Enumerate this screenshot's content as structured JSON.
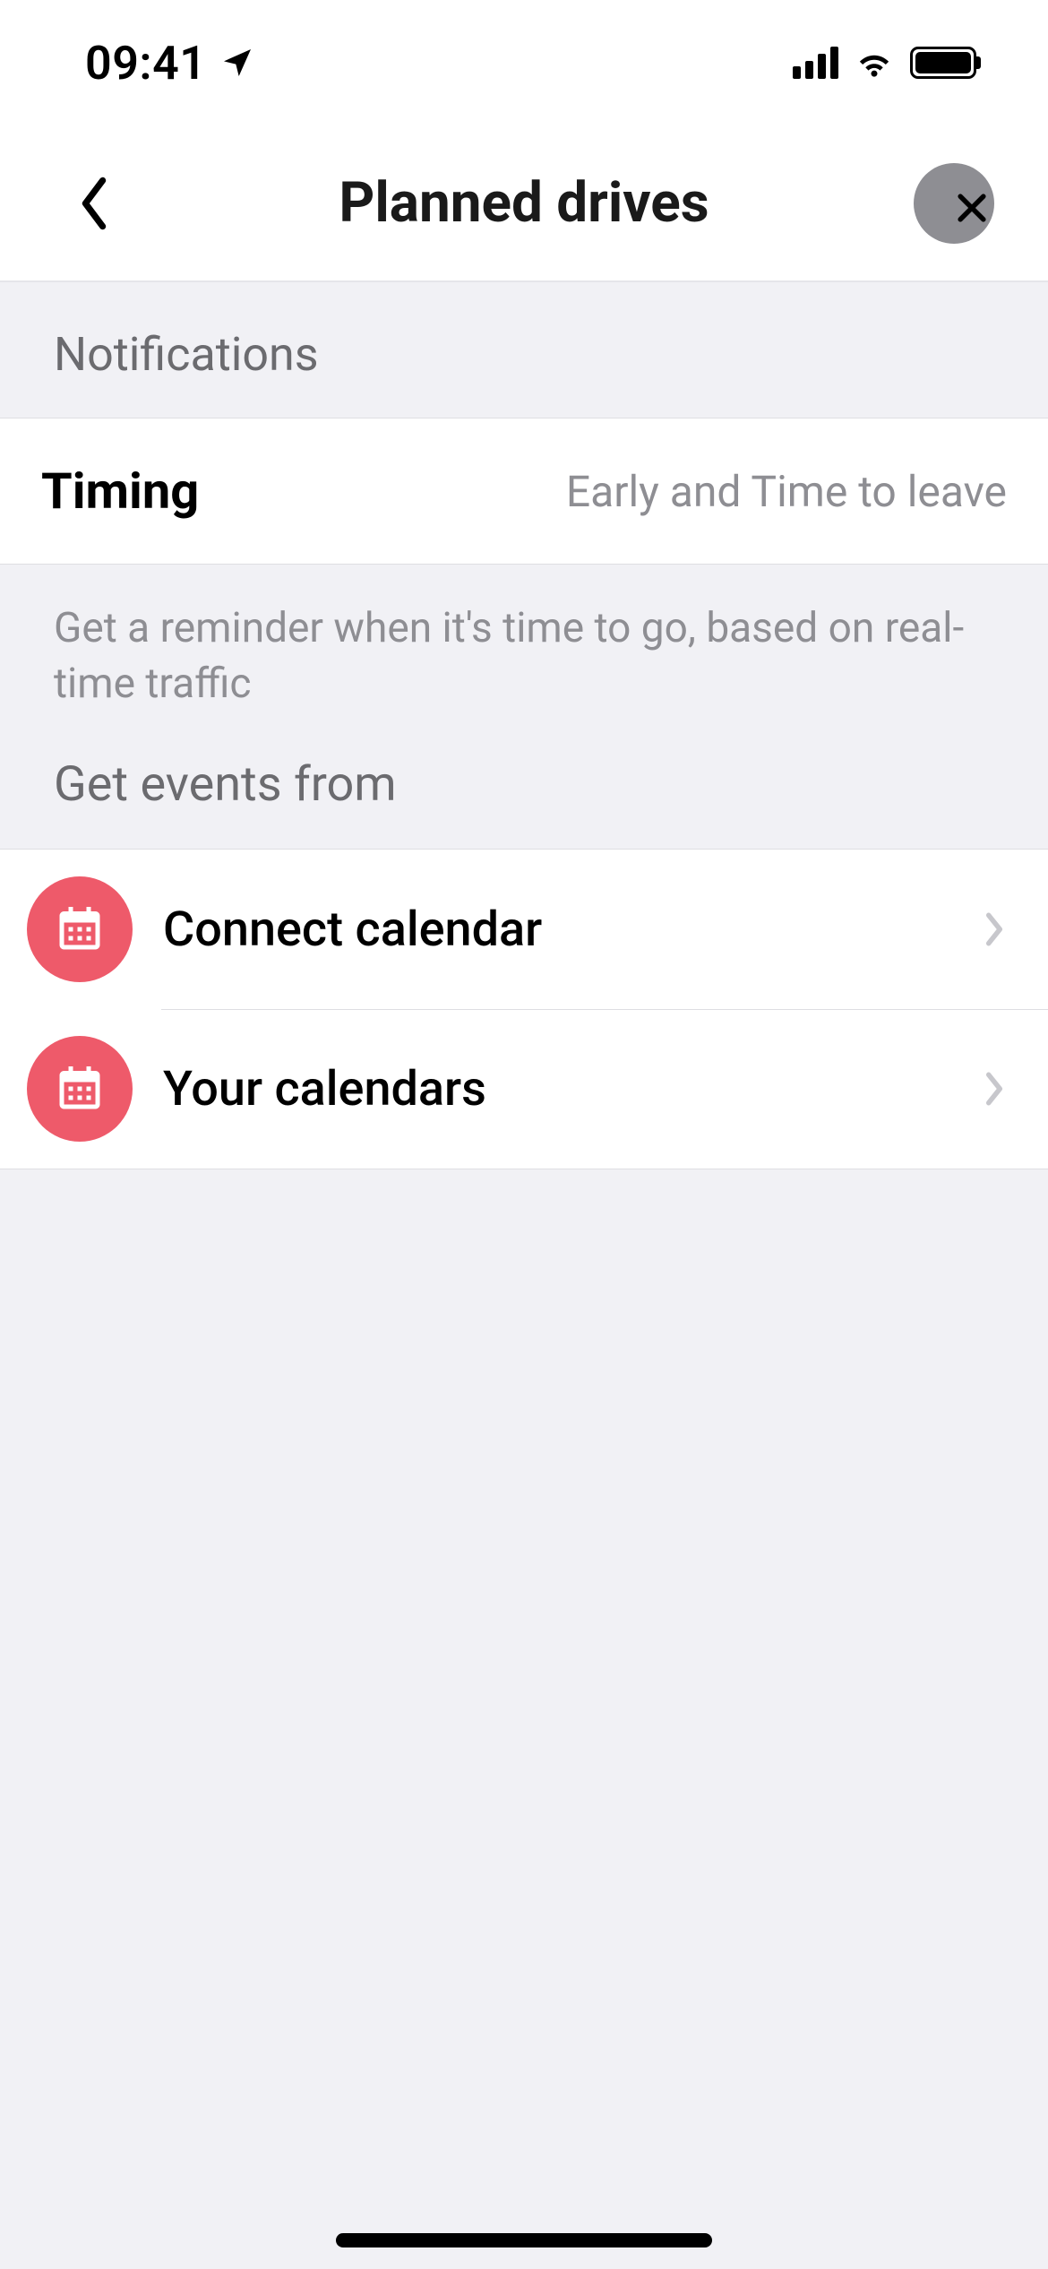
{
  "status": {
    "time": "09:41"
  },
  "nav": {
    "title": "Planned drives"
  },
  "sections": {
    "notifications_header": "Notifications",
    "timing": {
      "label": "Timing",
      "value": "Early and Time to leave"
    },
    "timing_desc": "Get a reminder when it's time to go, based on real-time traffic",
    "events_header": "Get events from",
    "items": [
      {
        "label": "Connect calendar"
      },
      {
        "label": "Your calendars"
      }
    ]
  },
  "colors": {
    "accent": "#ee5a6a"
  }
}
